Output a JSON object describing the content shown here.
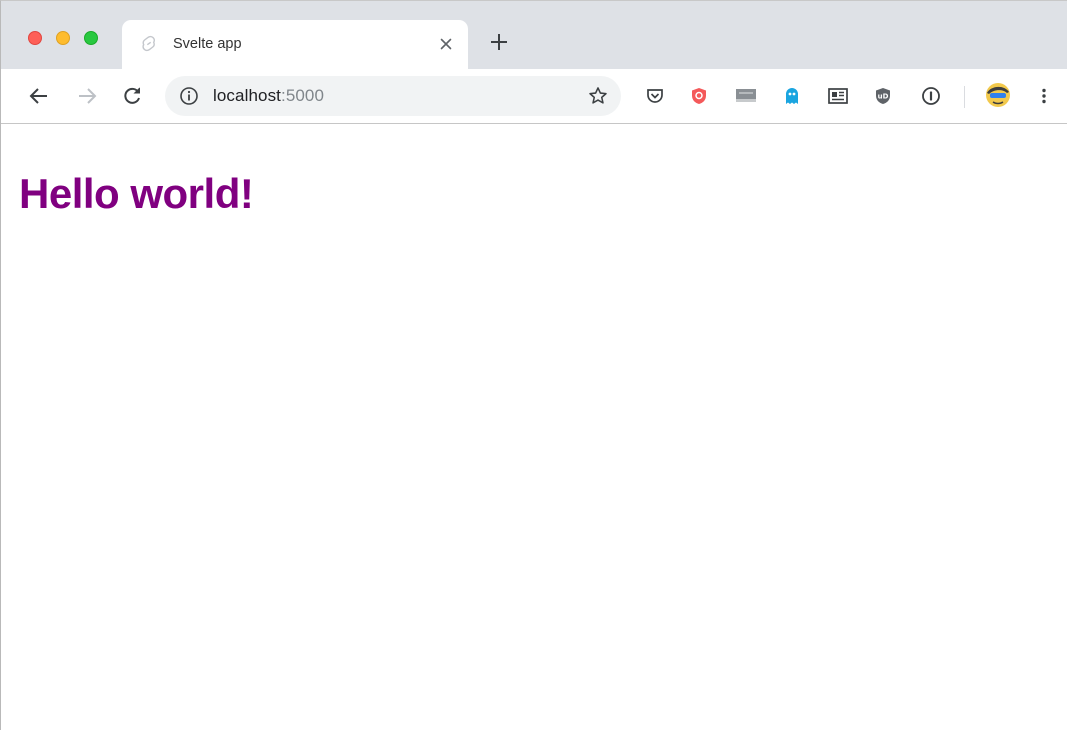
{
  "browser": {
    "tab": {
      "title": "Svelte app",
      "favicon": "svelte-favicon-icon",
      "close_icon": "close-icon"
    },
    "new_tab_icon": "plus-icon",
    "toolbar": {
      "back_icon": "arrow-left-icon",
      "forward_icon": "arrow-right-icon",
      "reload_icon": "reload-icon",
      "address": {
        "host": "localhost",
        "port": ":5000",
        "info_icon": "info-icon",
        "bookmark_icon": "star-icon"
      },
      "extensions": [
        "pocket-icon",
        "red-shield-icon",
        "screenshot-extension-icon",
        "ghost-icon",
        "reader-mode-icon",
        "ublock-origin-icon",
        "1password-icon",
        "profile-avatar-icon",
        "menu-kebab-icon"
      ]
    }
  },
  "page": {
    "heading": "Hello world!",
    "heading_color": "#800080"
  }
}
